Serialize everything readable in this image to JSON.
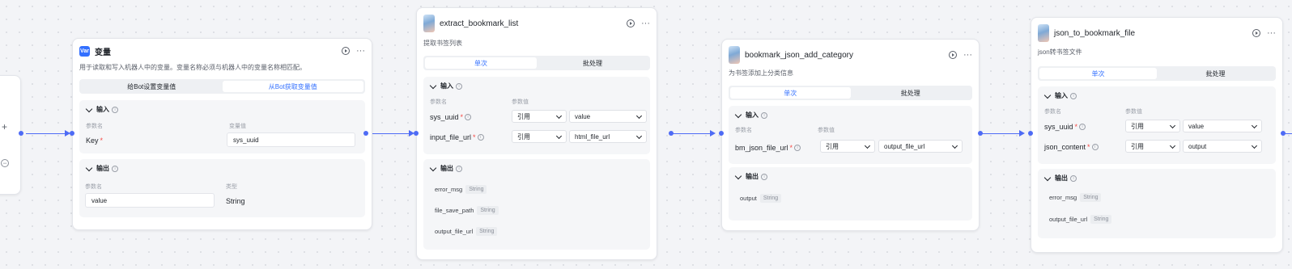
{
  "left_stub": {
    "plus": "+",
    "minus": "−"
  },
  "tabs_common": {
    "single": "单次",
    "batch": "批处理"
  },
  "labels": {
    "input": "输入",
    "output": "输出",
    "param_name": "参数名",
    "param_value": "参数值",
    "var_value": "变量值",
    "type": "类型",
    "ref": "引用",
    "info": "i"
  },
  "nodes": {
    "variable": {
      "title": "变量",
      "icon_text": "Var",
      "desc": "用于读取和写入机器人中的变量。变量名称必须与机器人中的变量名称相匹配。",
      "tab_set": "给Bot设置变量值",
      "tab_get": "从Bot获取变量值",
      "input_key": "Key",
      "input_value": "sys_uuid",
      "output_name": "value",
      "output_type": "String"
    },
    "extract": {
      "title": "extract_bookmark_list",
      "desc": "提取书签列表",
      "inputs": [
        {
          "name": "sys_uuid",
          "ref": "引用",
          "value": "value"
        },
        {
          "name": "input_file_url",
          "ref": "引用",
          "value": "html_file_url"
        }
      ],
      "outputs": [
        {
          "name": "error_msg",
          "type": "String"
        },
        {
          "name": "file_save_path",
          "type": "String"
        },
        {
          "name": "output_file_url",
          "type": "String"
        }
      ]
    },
    "category": {
      "title": "bookmark_json_add_category",
      "desc": "为书签添加上分类信息",
      "inputs": [
        {
          "name": "bm_json_file_url",
          "ref": "引用",
          "value": "output_file_url"
        }
      ],
      "outputs": [
        {
          "name": "output",
          "type": "String"
        }
      ]
    },
    "tobookmark": {
      "title": "json_to_bookmark_file",
      "desc": "json转书签文件",
      "inputs": [
        {
          "name": "sys_uuid",
          "ref": "引用",
          "value": "value"
        },
        {
          "name": "json_content",
          "ref": "引用",
          "value": "output"
        }
      ],
      "outputs": [
        {
          "name": "error_msg",
          "type": "String"
        },
        {
          "name": "output_file_url",
          "type": "String"
        }
      ]
    }
  },
  "colors": {
    "accent": "#3370ff",
    "edge": "#4e6bf5",
    "required": "#f54a45"
  }
}
